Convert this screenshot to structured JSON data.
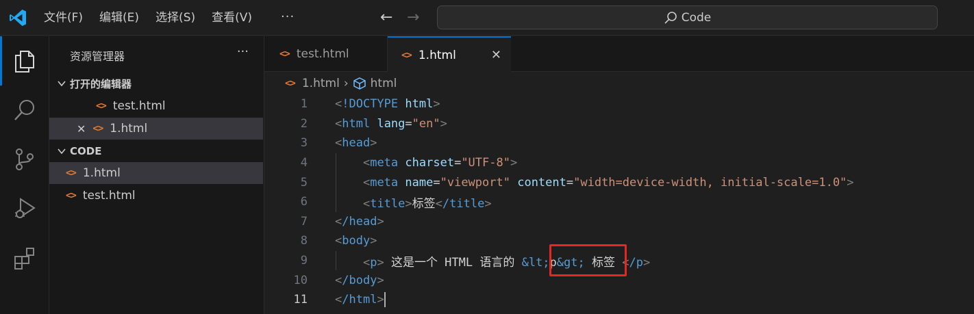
{
  "titlebar": {
    "menu": [
      "文件(F)",
      "编辑(E)",
      "选择(S)",
      "查看(V)"
    ],
    "more": "···",
    "search_text": "Code"
  },
  "activity_bar": {
    "items": [
      "explorer-icon",
      "search-icon",
      "source-control-icon",
      "run-debug-icon",
      "extensions-icon"
    ],
    "active": "explorer-icon"
  },
  "sidebar": {
    "title": "资源管理器",
    "more": "···",
    "open_editors": {
      "label": "打开的编辑器",
      "items": [
        {
          "name": "test.html",
          "icon": "<>"
        },
        {
          "name": "1.html",
          "icon": "<>",
          "close": "✕"
        }
      ]
    },
    "folder": {
      "label": "CODE",
      "items": [
        {
          "name": "1.html",
          "icon": "<>"
        },
        {
          "name": "test.html",
          "icon": "<>"
        }
      ]
    }
  },
  "tabs": [
    {
      "label": "test.html",
      "icon": "<>",
      "active": false
    },
    {
      "label": "1.html",
      "icon": "<>",
      "active": true,
      "close": "✕"
    }
  ],
  "breadcrumb": {
    "file": "1.html",
    "symbol": "html"
  },
  "editor": {
    "line_numbers": [
      "1",
      "2",
      "3",
      "4",
      "5",
      "6",
      "7",
      "8",
      "9",
      "10",
      "11"
    ],
    "current_line": "11",
    "lines": [
      {
        "punct_open": "<",
        "tag": "!DOCTYPE",
        "text": " html",
        "punct_close": ">"
      },
      {
        "tag": "html",
        "attr": "lang",
        "value": "\"en\""
      },
      {
        "tag": "head"
      },
      {
        "tag": "meta",
        "attr": "charset",
        "value": "\"UTF-8\""
      },
      {
        "tag": "meta",
        "attr1": "name",
        "value1": "\"viewport\"",
        "attr2": "content",
        "value2": "\"width=device-width, initial-scale=1.0\""
      },
      {
        "tag": "title",
        "text": "标签",
        "close_tag": "/title"
      },
      {
        "tag": "/head"
      },
      {
        "tag": "body"
      },
      {
        "tag": "p",
        "text1": " 这是一个 HTML 语言的 ",
        "entity1": "&lt;",
        "mid": "p",
        "entity2": "&gt;",
        "text2": " 标签 ",
        "close_tag": "/p"
      },
      {
        "tag": "/body"
      },
      {
        "tag": "/html"
      }
    ]
  },
  "colors": {
    "accent": "#0078d4",
    "highlight_box": "#e8281e",
    "html_icon": "#e37933",
    "tag": "#569cd6",
    "attribute": "#9cdcfe",
    "string": "#ce9178"
  }
}
